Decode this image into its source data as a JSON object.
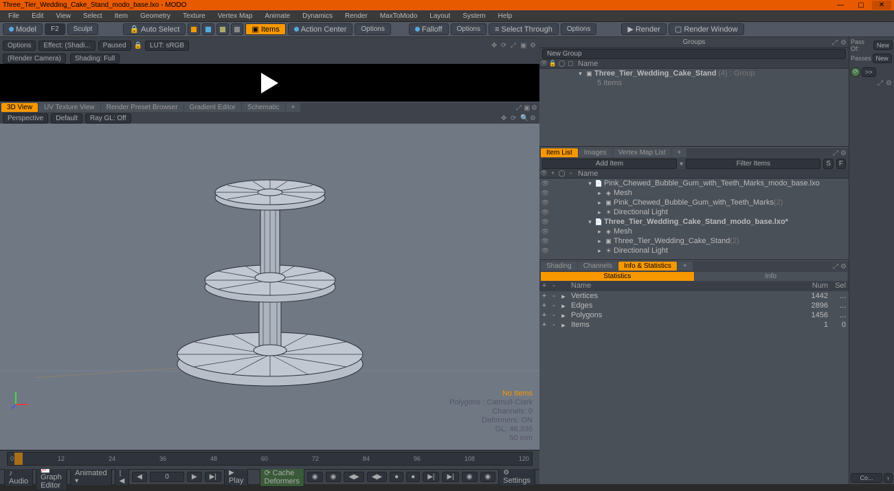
{
  "window": {
    "title": "Three_Tier_Wedding_Cake_Stand_modo_base.lxo - MODO"
  },
  "menu": [
    "File",
    "Edit",
    "View",
    "Select",
    "Item",
    "Geometry",
    "Texture",
    "Vertex Map",
    "Animate",
    "Dynamics",
    "Render",
    "MaxToModo",
    "Layout",
    "System",
    "Help"
  ],
  "toolbar": {
    "model": "Model",
    "f2": "F2",
    "sculpt": "Sculpt",
    "auto_select": "Auto Select",
    "items": "Items",
    "action_center": "Action Center",
    "options1": "Options",
    "falloff": "Falloff",
    "options2": "Options",
    "select_through": "Select Through",
    "options3": "Options",
    "render": "Render",
    "render_window": "Render Window"
  },
  "preview": {
    "options": "Options",
    "effect": "Effect: (Shadi...",
    "paused": "Paused",
    "lut": "LUT: sRGB",
    "render_camera": "(Render Camera)",
    "shading": "Shading: Full"
  },
  "viewport": {
    "tabs": [
      "3D View",
      "UV Texture View",
      "Render Preset Browser",
      "Gradient Editor",
      "Schematic"
    ],
    "active_tab": 0,
    "opts": {
      "perspective": "Perspective",
      "default": "Default",
      "raygl": "Ray GL: Off"
    },
    "overlay": {
      "no_items": "No Items",
      "polygons": "Polygons : Catmull-Clark",
      "channels": "Channels: 0",
      "deformers": "Deformers: ON",
      "gl": "GL: 46,336",
      "scale": "50 mm"
    }
  },
  "timeline": {
    "marks": [
      "0",
      "12",
      "24",
      "36",
      "48",
      "60",
      "72",
      "84",
      "96",
      "108",
      "120"
    ],
    "end": "120"
  },
  "bottombar": {
    "audio": "Audio",
    "graph_editor": "Graph Editor",
    "animated": "Animated",
    "frame": "0",
    "play": "Play",
    "cache_deformers": "Cache Deformers",
    "settings": "Settings"
  },
  "groups": {
    "title": "Groups",
    "new_group": "New Group",
    "name_hdr": "Name",
    "root": "Three_Tier_Wedding_Cake_Stand",
    "root_meta": "(4) : Group",
    "child": "5 Items"
  },
  "itemlist": {
    "tabs": [
      "Item List",
      "Images",
      "Vertex Map List"
    ],
    "active_tab": 0,
    "add_item": "Add Item",
    "filter_items": "Filter Items",
    "name_hdr": "Name",
    "rows": [
      {
        "indent": 1,
        "icon": "scene",
        "text": "Pink_Chewed_Bubble_Gum_with_Teeth_Marks_modo_base.lxo"
      },
      {
        "indent": 2,
        "icon": "mesh",
        "text": "Mesh"
      },
      {
        "indent": 2,
        "icon": "item",
        "text": "Pink_Chewed_Bubble_Gum_with_Teeth_Marks",
        "suffix": "(2)"
      },
      {
        "indent": 2,
        "icon": "light",
        "text": "Directional Light"
      },
      {
        "indent": 1,
        "icon": "scene",
        "text": "Three_Tier_Wedding_Cake_Stand_modo_base.lxo*",
        "bold": true
      },
      {
        "indent": 2,
        "icon": "mesh",
        "text": "Mesh"
      },
      {
        "indent": 2,
        "icon": "item",
        "text": "Three_Tier_Wedding_Cake_Stand",
        "suffix": "(2)"
      },
      {
        "indent": 2,
        "icon": "light",
        "text": "Directional Light"
      }
    ]
  },
  "stats_tabs": {
    "tabs": [
      "Shading",
      "Channels",
      "Info & Statistics"
    ],
    "active": 2
  },
  "stats_sub": {
    "tabs": [
      "Statistics",
      "Info"
    ],
    "active": 0
  },
  "stats": {
    "hdr": {
      "name": "Name",
      "num": "Num",
      "sel": "Sel"
    },
    "rows": [
      {
        "name": "Vertices",
        "num": "1442",
        "sel": "..."
      },
      {
        "name": "Edges",
        "num": "2896",
        "sel": "..."
      },
      {
        "name": "Polygons",
        "num": "1456",
        "sel": "..."
      },
      {
        "name": "Items",
        "num": "1",
        "sel": "0"
      }
    ]
  },
  "far_right": {
    "pass_of": "Pass Of:",
    "new1": "New",
    "passes": "Passes",
    "new2": "New",
    "co": "Co..."
  }
}
